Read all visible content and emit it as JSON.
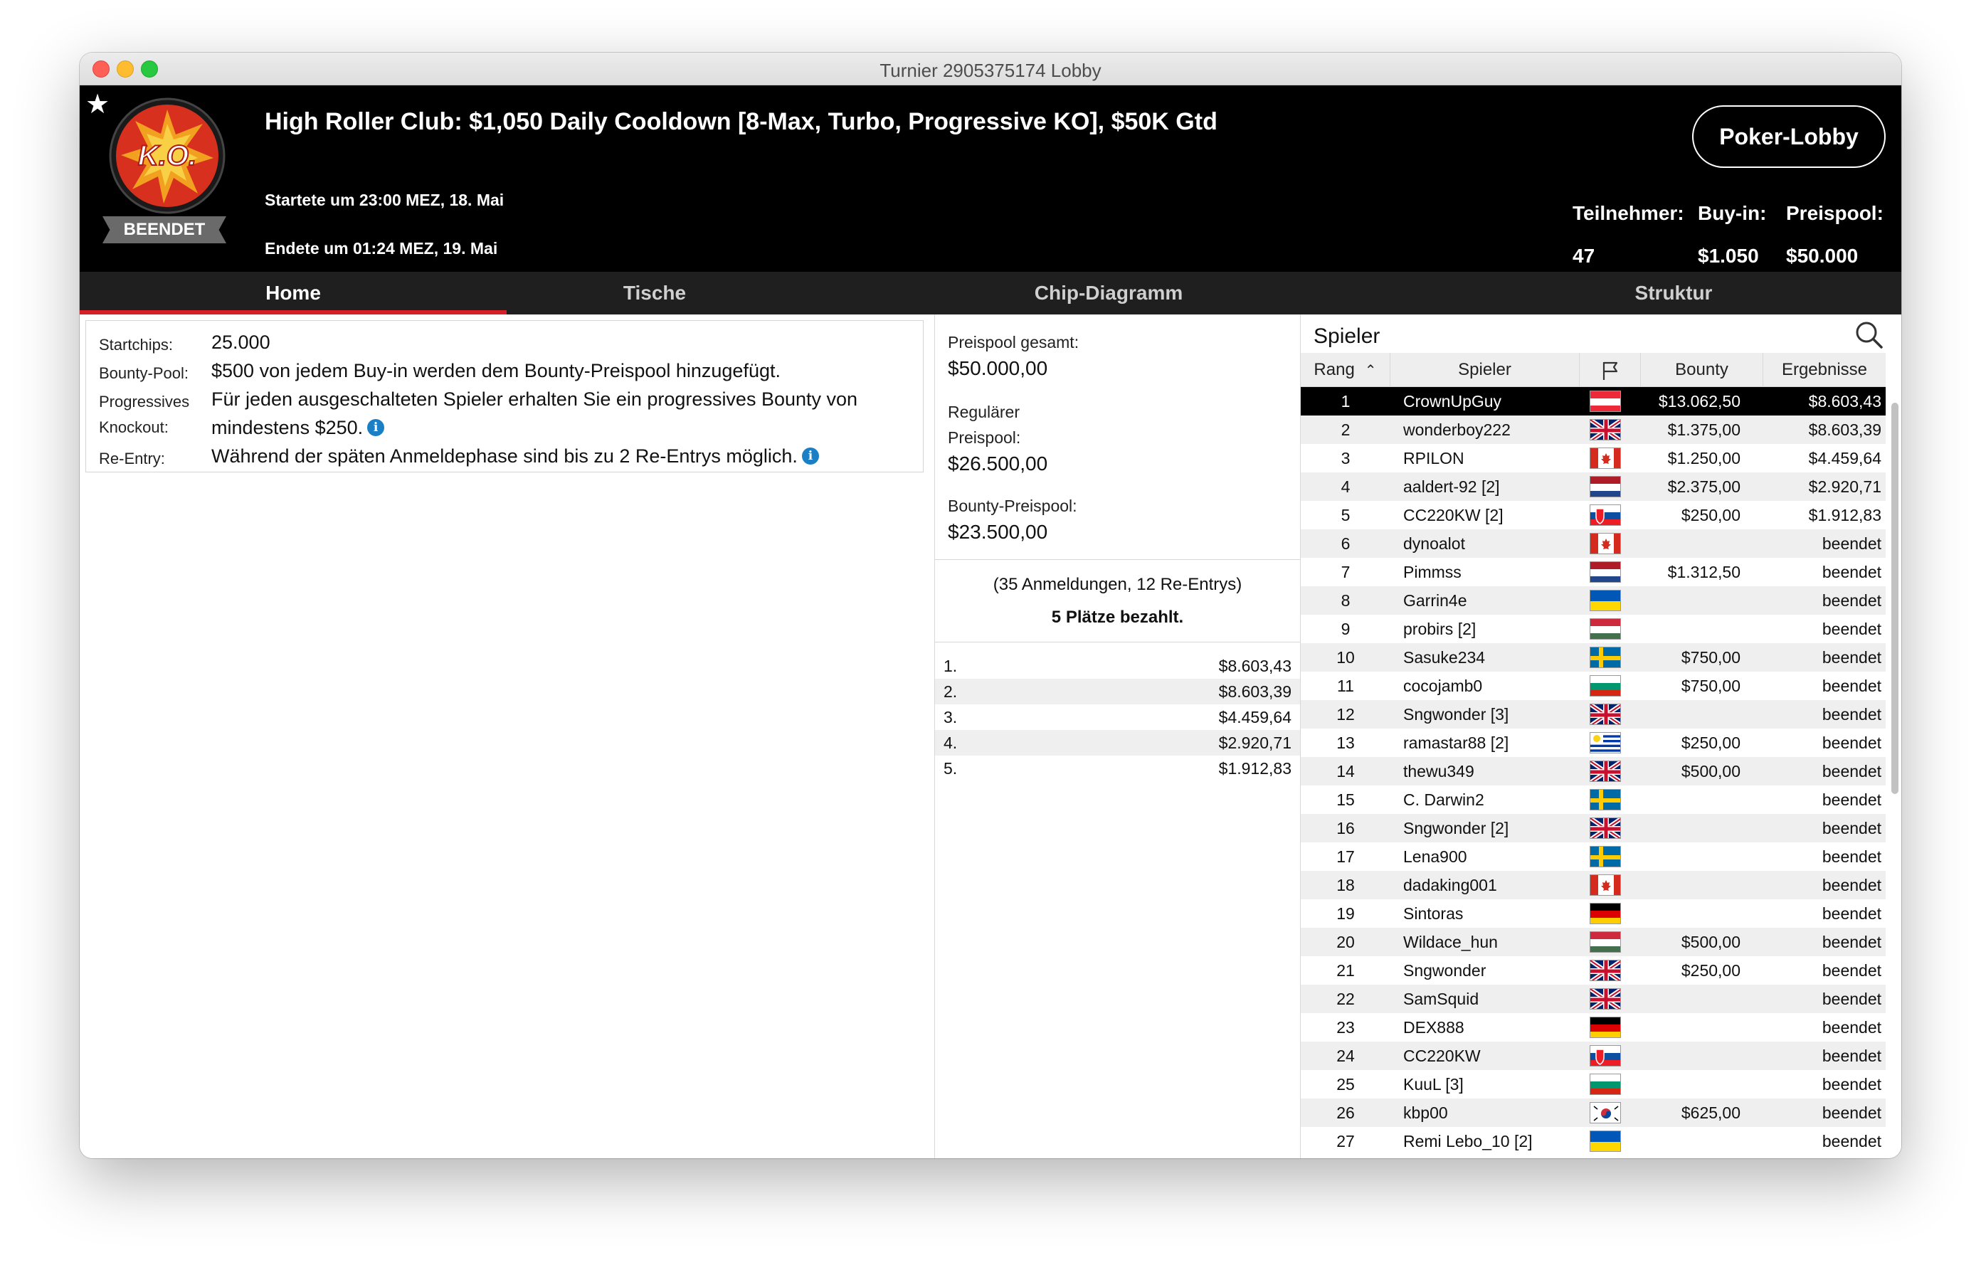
{
  "window": {
    "title": "Turnier 2905375174 Lobby"
  },
  "header": {
    "badge": "BEENDET",
    "logo_text": "K.O.",
    "tournament_name": "High Roller Club: $1,050 Daily Cooldown [8-Max, Turbo, Progressive KO], $50K Gtd",
    "started": "Startete um 23:00 MEZ, 18. Mai",
    "ended": "Endete um 01:24 MEZ, 19. Mai",
    "lobby_button": "Poker-Lobby",
    "stats": {
      "participants_label": "Teilnehmer:",
      "participants_value": "47",
      "buyin_label": "Buy-in:",
      "buyin_value": "$1.050",
      "prizepool_label": "Preispool:",
      "prizepool_value": "$50.000"
    }
  },
  "tabs": [
    "Home",
    "Tische",
    "Chip-Diagramm",
    "Struktur"
  ],
  "info": {
    "startchips_label": "Startchips:",
    "startchips_value": "25.000",
    "bountypool_label": "Bounty-Pool:",
    "bountypool_value": "$500 von jedem Buy-in werden dem Bounty-Preispool hinzugefügt.",
    "knockout_label1": "Progressives",
    "knockout_label2": "Knockout:",
    "knockout_value1": "Für jeden ausgeschalteten Spieler erhalten Sie ein progressives Bounty von",
    "knockout_value2": "mindestens $250.",
    "reentry_label": "Re-Entry:",
    "reentry_value": "Während der späten Anmeldephase sind bis zu 2 Re-Entrys möglich."
  },
  "prizes": {
    "total_label": "Preispool gesamt:",
    "total_value": "$50.000,00",
    "regular_label1": "Regulärer",
    "regular_label2": "Preispool:",
    "regular_value": "$26.500,00",
    "bounty_label": "Bounty-Preispool:",
    "bounty_value": "$23.500,00",
    "registrations": "(35 Anmeldungen, 12 Re-Entrys)",
    "paid": "5 Plätze bezahlt.",
    "payouts": [
      {
        "pos": "1.",
        "amount": "$8.603,43"
      },
      {
        "pos": "2.",
        "amount": "$8.603,39"
      },
      {
        "pos": "3.",
        "amount": "$4.459,64"
      },
      {
        "pos": "4.",
        "amount": "$2.920,71"
      },
      {
        "pos": "5.",
        "amount": "$1.912,83"
      }
    ]
  },
  "players": {
    "title": "Spieler",
    "columns": {
      "rank": "Rang",
      "player": "Spieler",
      "bounty": "Bounty",
      "result": "Ergebnisse"
    },
    "rows": [
      {
        "rank": "1",
        "name": "CrownUpGuy",
        "flag": "austria",
        "bounty": "$13.062,50",
        "result": "$8.603,43"
      },
      {
        "rank": "2",
        "name": "wonderboy222",
        "flag": "uk",
        "bounty": "$1.375,00",
        "result": "$8.603,39"
      },
      {
        "rank": "3",
        "name": "RPILON",
        "flag": "canada",
        "bounty": "$1.250,00",
        "result": "$4.459,64"
      },
      {
        "rank": "4",
        "name": "aaldert-92 [2]",
        "flag": "netherlands",
        "bounty": "$2.375,00",
        "result": "$2.920,71"
      },
      {
        "rank": "5",
        "name": "CC220KW [2]",
        "flag": "slovakia",
        "bounty": "$250,00",
        "result": "$1.912,83"
      },
      {
        "rank": "6",
        "name": "dynoalot",
        "flag": "canada",
        "bounty": "",
        "result": "beendet"
      },
      {
        "rank": "7",
        "name": "Pimmss",
        "flag": "netherlands",
        "bounty": "$1.312,50",
        "result": "beendet"
      },
      {
        "rank": "8",
        "name": "Garrin4e",
        "flag": "ukraine",
        "bounty": "",
        "result": "beendet"
      },
      {
        "rank": "9",
        "name": "probirs [2]",
        "flag": "hungary",
        "bounty": "",
        "result": "beendet"
      },
      {
        "rank": "10",
        "name": "Sasuke234",
        "flag": "sweden",
        "bounty": "$750,00",
        "result": "beendet"
      },
      {
        "rank": "11",
        "name": "cocojamb0",
        "flag": "bulgaria",
        "bounty": "$750,00",
        "result": "beendet"
      },
      {
        "rank": "12",
        "name": "Sngwonder [3]",
        "flag": "uk",
        "bounty": "",
        "result": "beendet"
      },
      {
        "rank": "13",
        "name": "ramastar88 [2]",
        "flag": "uruguay",
        "bounty": "$250,00",
        "result": "beendet"
      },
      {
        "rank": "14",
        "name": "thewu349",
        "flag": "uk",
        "bounty": "$500,00",
        "result": "beendet"
      },
      {
        "rank": "15",
        "name": "C. Darwin2",
        "flag": "sweden",
        "bounty": "",
        "result": "beendet"
      },
      {
        "rank": "16",
        "name": "Sngwonder [2]",
        "flag": "uk",
        "bounty": "",
        "result": "beendet"
      },
      {
        "rank": "17",
        "name": "Lena900",
        "flag": "sweden",
        "bounty": "",
        "result": "beendet"
      },
      {
        "rank": "18",
        "name": "dadaking001",
        "flag": "canada",
        "bounty": "",
        "result": "beendet"
      },
      {
        "rank": "19",
        "name": "Sintoras",
        "flag": "germany",
        "bounty": "",
        "result": "beendet"
      },
      {
        "rank": "20",
        "name": "Wildace_hun",
        "flag": "hungary",
        "bounty": "$500,00",
        "result": "beendet"
      },
      {
        "rank": "21",
        "name": "Sngwonder",
        "flag": "uk",
        "bounty": "$250,00",
        "result": "beendet"
      },
      {
        "rank": "22",
        "name": "SamSquid",
        "flag": "uk",
        "bounty": "",
        "result": "beendet"
      },
      {
        "rank": "23",
        "name": "DEX888",
        "flag": "germany",
        "bounty": "",
        "result": "beendet"
      },
      {
        "rank": "24",
        "name": "CC220KW",
        "flag": "slovakia",
        "bounty": "",
        "result": "beendet"
      },
      {
        "rank": "25",
        "name": "KuuL [3]",
        "flag": "bulgaria",
        "bounty": "",
        "result": "beendet"
      },
      {
        "rank": "26",
        "name": "kbp00",
        "flag": "korea",
        "bounty": "$625,00",
        "result": "beendet"
      },
      {
        "rank": "27",
        "name": "Remi Lebo_10 [2]",
        "flag": "ukraine",
        "bounty": "",
        "result": "beendet"
      }
    ]
  },
  "colors": {
    "accent_red": "#d5202a",
    "header_bg": "#000000",
    "tab_bg": "#1f1f1f"
  }
}
